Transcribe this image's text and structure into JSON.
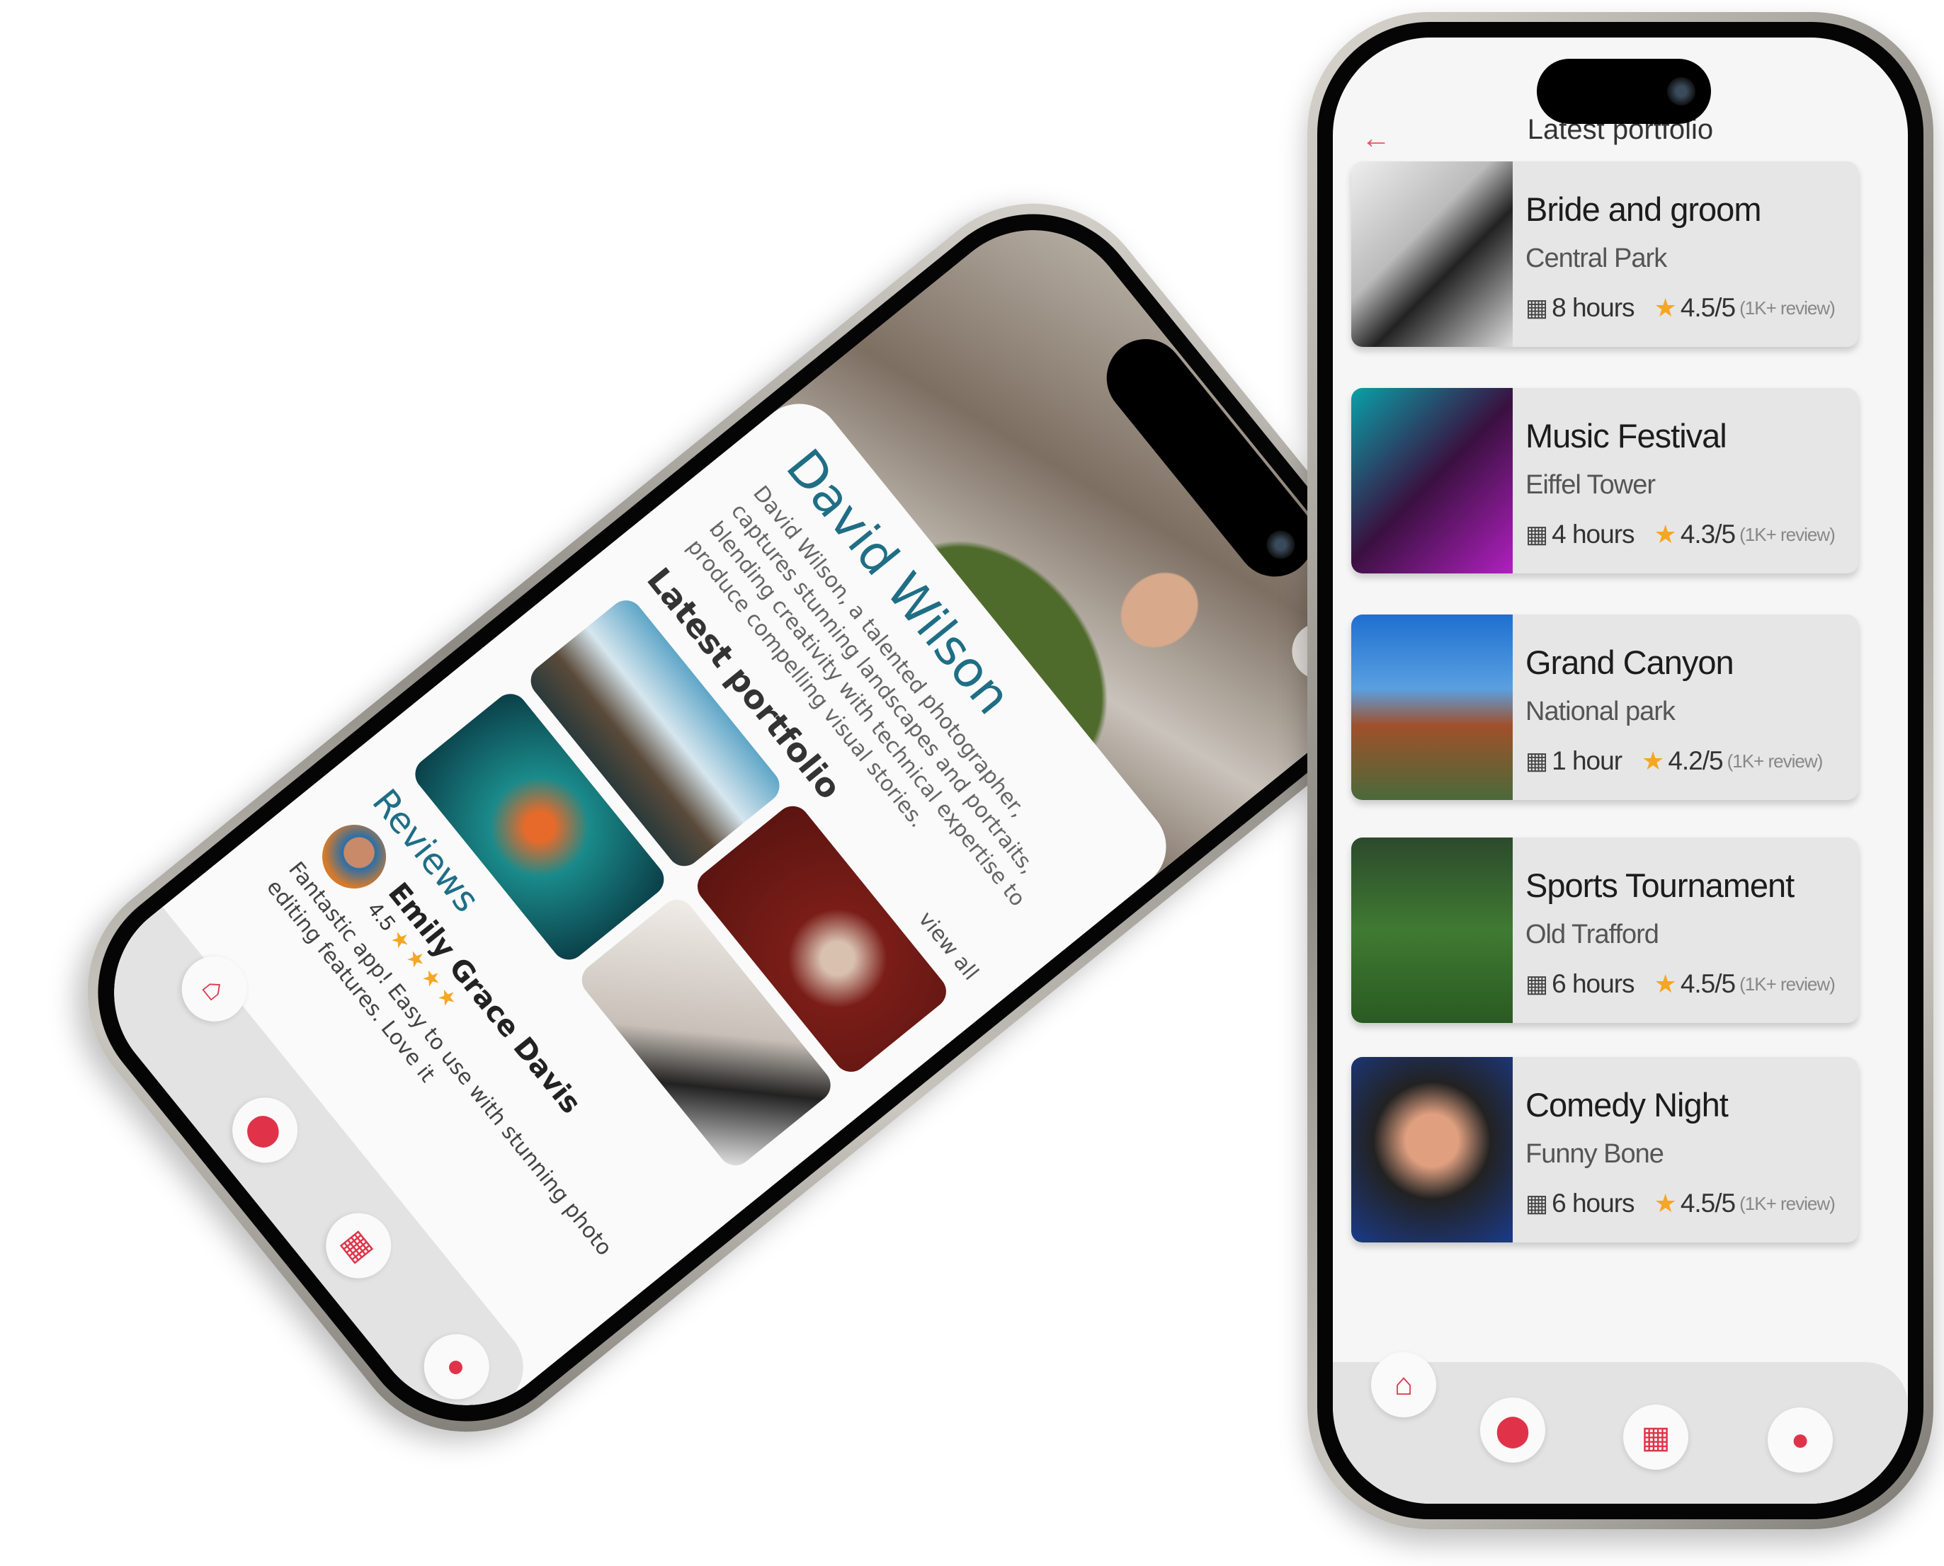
{
  "right_phone": {
    "title": "Latest portfolio",
    "back_icon": "arrow-left-icon",
    "accent": "#e0334a",
    "items": [
      {
        "title": "Bride and groom",
        "location": "Central Park",
        "duration": "8 hours",
        "rating": "4.5/5",
        "reviews": "(1K+ review)"
      },
      {
        "title": "Music Festival",
        "location": "Eiffel Tower",
        "duration": "4 hours",
        "rating": "4.3/5",
        "reviews": "(1K+ review)"
      },
      {
        "title": "Grand Canyon",
        "location": "National park",
        "duration": "1 hour",
        "rating": "4.2/5",
        "reviews": "(1K+ review)"
      },
      {
        "title": "Sports Tournament",
        "location": "Old Trafford",
        "duration": "6 hours",
        "rating": "4.5/5",
        "reviews": "(1K+ review)"
      },
      {
        "title": "Comedy Night",
        "location": "Funny Bone",
        "duration": "6 hours",
        "rating": "4.5/5",
        "reviews": "(1K+ review)"
      }
    ],
    "nav": [
      "home-icon",
      "location-pin-icon",
      "calendar-icon",
      "user-icon"
    ]
  },
  "left_phone": {
    "name": "David Wilson",
    "description": "David Wilson, a talented photographer, captures stunning landscapes and portraits, blending creativity with technical expertise to produce compelling visual stories.",
    "portfolio_heading": "Latest portfolio",
    "view_all": "view all",
    "reviews_heading": "Reviews",
    "review": {
      "name": "Emily Grace Davis",
      "score": "4.5",
      "stars": 4,
      "text": "Fantastic app! Easy to use with stunning photo editing features. Love it"
    },
    "name_color": "#1f6e86"
  }
}
